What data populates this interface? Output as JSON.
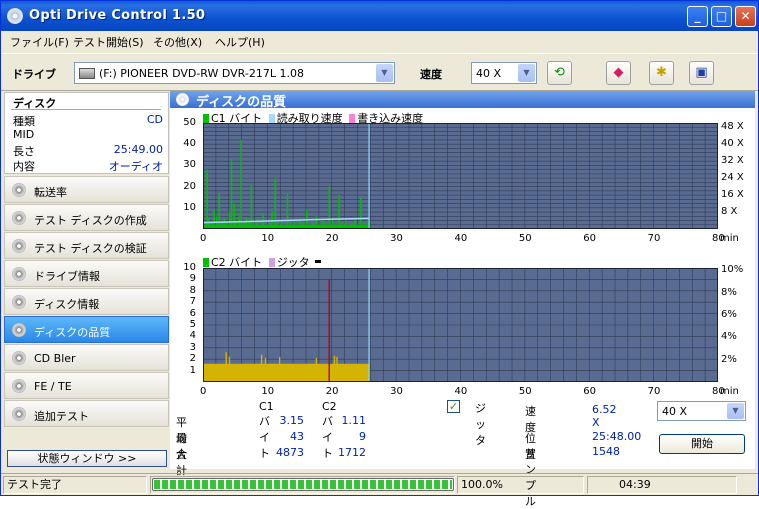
{
  "window": {
    "title": "Opti Drive Control 1.50"
  },
  "menu": [
    "ファイル(F)",
    "テスト開始(S)",
    "その他(X)",
    "ヘルプ(H)"
  ],
  "toolbar": {
    "drive_label": "ドライブ",
    "drive_value": "(F:)   PIONEER DVD-RW  DVR-217L 1.08",
    "speed_label": "速度",
    "speed_value": "40 X"
  },
  "disc": {
    "header": "ディスク",
    "rows": [
      {
        "key": "種類",
        "value": "CD"
      },
      {
        "key": "MID",
        "value": ""
      },
      {
        "key": "長さ",
        "value": "25:49.00"
      },
      {
        "key": "内容",
        "value": "オーディオ"
      }
    ]
  },
  "nav": [
    {
      "label": "転送率"
    },
    {
      "label": "テスト ディスクの作成"
    },
    {
      "label": "テスト ディスクの検証"
    },
    {
      "label": "ドライブ情報"
    },
    {
      "label": "ディスク情報"
    },
    {
      "label": "ディスクの品質",
      "selected": true
    },
    {
      "label": "CD Bler"
    },
    {
      "label": "FE / TE"
    },
    {
      "label": "追加テスト"
    }
  ],
  "status_window_button": "状態ウィンドウ >>",
  "panel_title": "ディスクの品質",
  "chart_data": [
    {
      "type": "bar",
      "legend": [
        "C1 バイト",
        "読み取り速度",
        "書き込み速度"
      ],
      "colors": {
        "c1": "#00c000",
        "read": "#a8d8ff",
        "write": "#ff80d0",
        "bg": "#5a6b91",
        "grid": "#2f3a55"
      },
      "x_ticks": [
        0,
        10,
        20,
        30,
        40,
        50,
        60,
        70,
        80
      ],
      "x_unit": "min",
      "y_ticks_left": [
        10,
        20,
        30,
        40,
        50
      ],
      "y_ticks_right": [
        "8 X",
        "16 X",
        "24 X",
        "32 X",
        "40 X",
        "48 X"
      ],
      "xlim": [
        0,
        80
      ],
      "ylim": [
        0,
        50
      ],
      "end_marker_min": 25.8,
      "spikes": [
        [
          0.3,
          2
        ],
        [
          0.5,
          28
        ],
        [
          0.8,
          5
        ],
        [
          1.2,
          3
        ],
        [
          1.6,
          9
        ],
        [
          2.0,
          6
        ],
        [
          2.4,
          17
        ],
        [
          2.8,
          4
        ],
        [
          3.2,
          5
        ],
        [
          3.6,
          3
        ],
        [
          4.0,
          8
        ],
        [
          4.3,
          33
        ],
        [
          4.7,
          12
        ],
        [
          5.0,
          4
        ],
        [
          5.5,
          6
        ],
        [
          5.8,
          42
        ],
        [
          6.2,
          3
        ],
        [
          6.6,
          5
        ],
        [
          7.0,
          4
        ],
        [
          7.4,
          21
        ],
        [
          7.8,
          3
        ],
        [
          8.3,
          5
        ],
        [
          8.7,
          2
        ],
        [
          9.2,
          7
        ],
        [
          9.7,
          2
        ],
        [
          10.2,
          4
        ],
        [
          10.6,
          8
        ],
        [
          11.1,
          24
        ],
        [
          11.4,
          3
        ],
        [
          12.0,
          4
        ],
        [
          12.4,
          2
        ],
        [
          13.0,
          17
        ],
        [
          13.5,
          3
        ],
        [
          14.0,
          5
        ],
        [
          14.6,
          2
        ],
        [
          15.0,
          4
        ],
        [
          15.5,
          3
        ],
        [
          16.0,
          9
        ],
        [
          16.6,
          2
        ],
        [
          17.0,
          3
        ],
        [
          17.5,
          6
        ],
        [
          18.0,
          2
        ],
        [
          18.5,
          4
        ],
        [
          19.0,
          3
        ],
        [
          19.5,
          20
        ],
        [
          20.0,
          5
        ],
        [
          20.4,
          2
        ],
        [
          21.0,
          16
        ],
        [
          21.5,
          3
        ],
        [
          22.0,
          4
        ],
        [
          22.6,
          2
        ],
        [
          23.0,
          3
        ],
        [
          23.5,
          5
        ],
        [
          24.0,
          2
        ],
        [
          24.4,
          15
        ],
        [
          25.0,
          3
        ],
        [
          25.5,
          4
        ]
      ],
      "read_speed_start": 3,
      "read_speed_end": 5
    },
    {
      "type": "bar",
      "legend": [
        "C2 バイト",
        "ジッタ"
      ],
      "colors": {
        "c2": "#d4b400",
        "jitter": "#d0a0e0",
        "spike": "#c00000",
        "bg": "#5a6b91",
        "grid": "#2f3a55"
      },
      "x_ticks": [
        0,
        10,
        20,
        30,
        40,
        50,
        60,
        70,
        80
      ],
      "x_unit": "min",
      "y_ticks_left": [
        1,
        2,
        3,
        4,
        5,
        6,
        7,
        8,
        9,
        10
      ],
      "y_ticks_right": [
        "2%",
        "4%",
        "6%",
        "8%",
        "10%"
      ],
      "xlim": [
        0,
        80
      ],
      "ylim": [
        0,
        10
      ],
      "end_marker_min": 25.8,
      "base_level": 1.6,
      "spikes": [
        [
          3.5,
          2.6
        ],
        [
          4.0,
          2.2
        ],
        [
          9.0,
          2.4
        ],
        [
          9.6,
          2.1
        ],
        [
          11.8,
          2.2
        ],
        [
          17.5,
          2.1
        ],
        [
          19.5,
          9.0
        ],
        [
          20.3,
          2.3
        ],
        [
          20.7,
          2.2
        ]
      ]
    }
  ],
  "stats": {
    "col_c1": "C1 バイト",
    "col_c2": "C2 バイト",
    "rows": [
      {
        "label": "平均",
        "c1": "3.15",
        "c2": "1.11"
      },
      {
        "label": "最大",
        "c1": "43",
        "c2": "9"
      },
      {
        "label": "合計",
        "c1": "4873",
        "c2": "1712"
      }
    ],
    "jitter_label": "ジッタ",
    "speed_label": "速度",
    "speed_value": "6.52 X",
    "speed_select": "40 X",
    "position_label": "位置",
    "position_value": "25:48.00",
    "sample_label": "サンプル",
    "sample_value": "1548",
    "start_button": "開始"
  },
  "statusbar": {
    "text": "テスト完了",
    "progress_percent": 100,
    "progress_text": "100.0%",
    "time": "04:39"
  }
}
